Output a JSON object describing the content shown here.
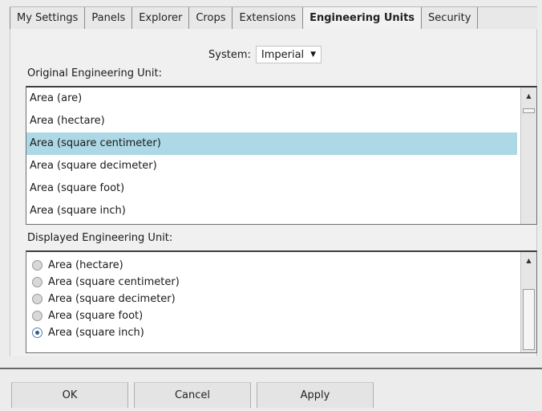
{
  "tabs": [
    {
      "label": "My Settings"
    },
    {
      "label": "Panels"
    },
    {
      "label": "Explorer"
    },
    {
      "label": "Crops"
    },
    {
      "label": "Extensions"
    },
    {
      "label": "Engineering Units",
      "active": true
    },
    {
      "label": "Security"
    }
  ],
  "system": {
    "label": "System:",
    "value": "Imperial"
  },
  "original": {
    "label": "Original Engineering Unit:",
    "items": [
      "Area (are)",
      "Area (hectare)",
      "Area (square centimeter)",
      "Area (square decimeter)",
      "Area (square foot)",
      "Area (square inch)"
    ],
    "selected": "Area (square centimeter)"
  },
  "displayed": {
    "label": "Displayed Engineering Unit:",
    "items": [
      "Area (hectare)",
      "Area (square centimeter)",
      "Area (square decimeter)",
      "Area (square foot)",
      "Area (square inch)"
    ],
    "checked": "Area (square inch)"
  },
  "buttons": {
    "ok": "OK",
    "cancel": "Cancel",
    "apply": "Apply"
  }
}
